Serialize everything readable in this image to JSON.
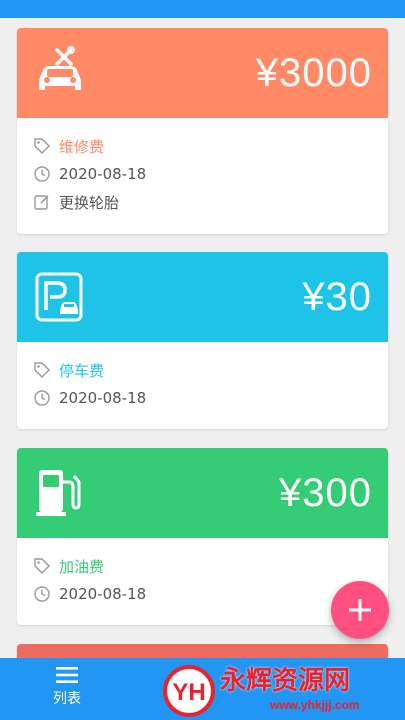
{
  "records": [
    {
      "amount": "¥3000",
      "category": "维修费",
      "date": "2020-08-18",
      "note": "更换轮胎",
      "color": "#ff8a65",
      "icon": "car-repair-icon"
    },
    {
      "amount": "¥30",
      "category": "停车费",
      "date": "2020-08-18",
      "color": "#1ec4e8",
      "icon": "parking-icon"
    },
    {
      "amount": "¥300",
      "category": "加油费",
      "date": "2020-08-18",
      "color": "#34cc74",
      "icon": "fuel-pump-icon"
    }
  ],
  "peek_card_color": "#ef6a60",
  "fab": {
    "icon": "plus-icon",
    "color": "#ff4f81"
  },
  "bottom_nav": {
    "list_label": "列表",
    "list_icon": "menu-icon"
  },
  "watermark": {
    "logo_text": "YH",
    "text": "永辉资源网",
    "url": "www.yhkjjj.com"
  }
}
